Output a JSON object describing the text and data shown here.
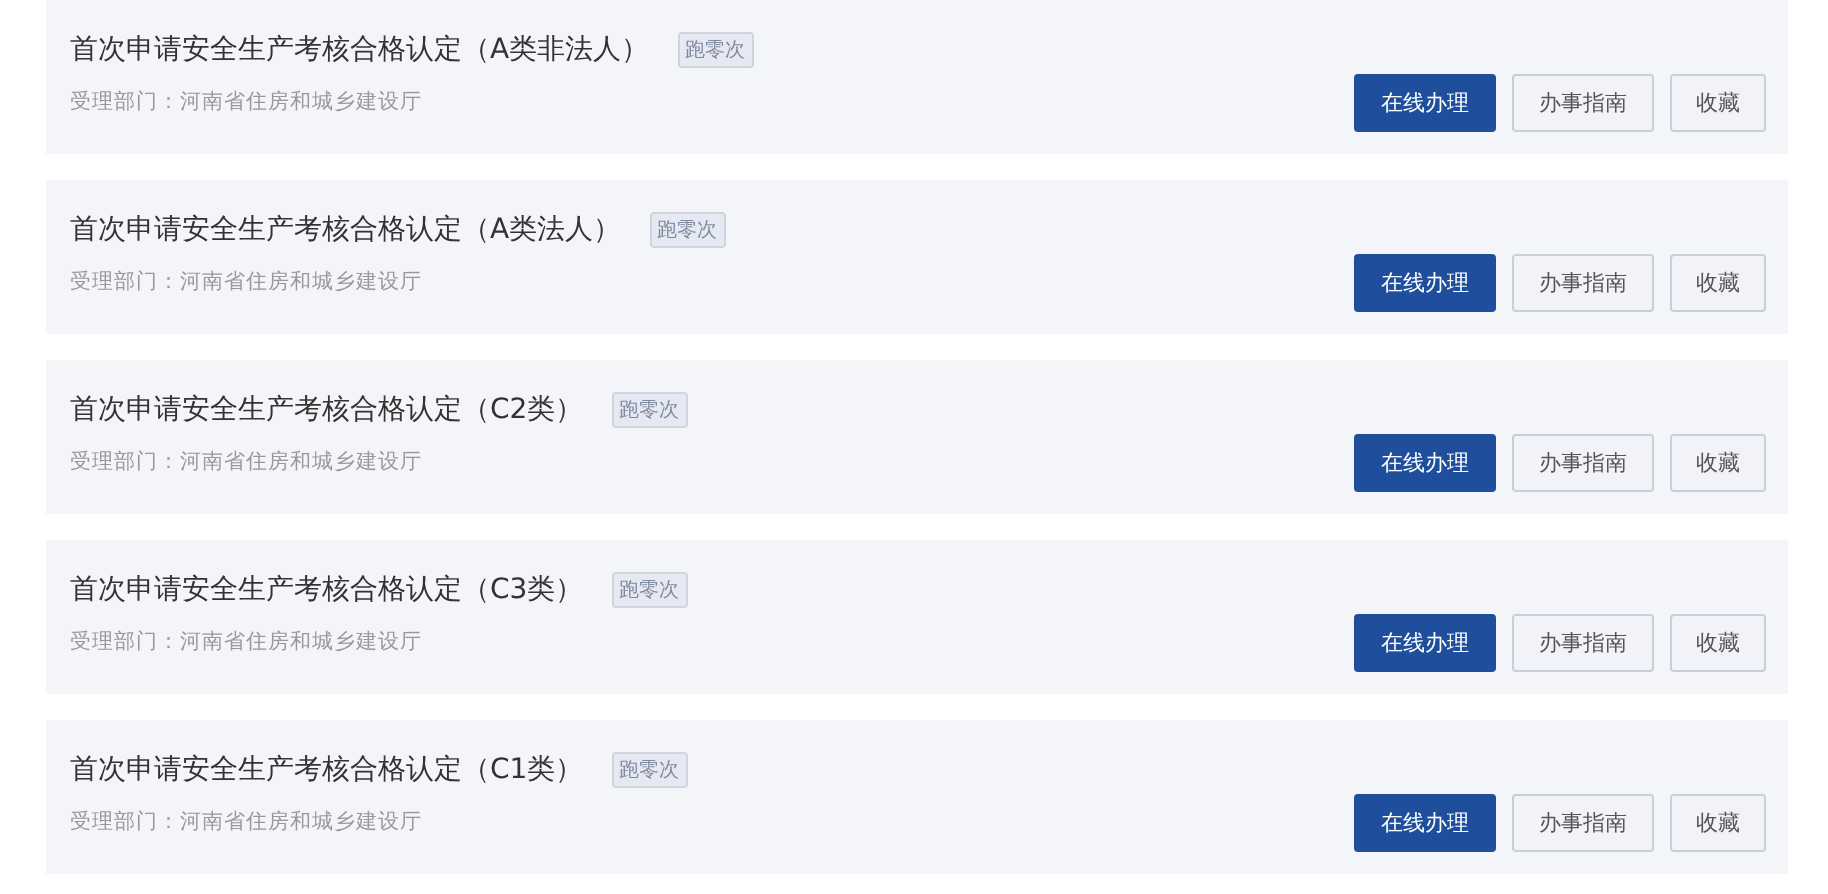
{
  "items": [
    {
      "title": "首次申请安全生产考核合格认定（A类非法人）",
      "badge": "跑零次",
      "department": "受理部门：河南省住房和城乡建设厅",
      "buttons": [
        {
          "label": "在线办理",
          "kind": "primary"
        },
        {
          "label": "办事指南",
          "kind": "secondary"
        },
        {
          "label": "收藏",
          "kind": "secondary"
        }
      ]
    },
    {
      "title": "首次申请安全生产考核合格认定（A类法人）",
      "badge": "跑零次",
      "department": "受理部门：河南省住房和城乡建设厅",
      "buttons": [
        {
          "label": "在线办理",
          "kind": "primary"
        },
        {
          "label": "办事指南",
          "kind": "secondary"
        },
        {
          "label": "收藏",
          "kind": "secondary"
        }
      ]
    },
    {
      "title": "首次申请安全生产考核合格认定（C2类）",
      "badge": "跑零次",
      "department": "受理部门：河南省住房和城乡建设厅",
      "buttons": [
        {
          "label": "在线办理",
          "kind": "primary"
        },
        {
          "label": "办事指南",
          "kind": "secondary"
        },
        {
          "label": "收藏",
          "kind": "secondary"
        }
      ]
    },
    {
      "title": "首次申请安全生产考核合格认定（C3类）",
      "badge": "跑零次",
      "department": "受理部门：河南省住房和城乡建设厅",
      "buttons": [
        {
          "label": "在线办理",
          "kind": "primary"
        },
        {
          "label": "办事指南",
          "kind": "secondary"
        },
        {
          "label": "收藏",
          "kind": "secondary"
        }
      ]
    },
    {
      "title": "首次申请安全生产考核合格认定（C1类）",
      "badge": "跑零次",
      "department": "受理部门：河南省住房和城乡建设厅",
      "buttons": [
        {
          "label": "在线办理",
          "kind": "primary"
        },
        {
          "label": "办事指南",
          "kind": "secondary"
        },
        {
          "label": "收藏",
          "kind": "secondary"
        }
      ]
    }
  ]
}
